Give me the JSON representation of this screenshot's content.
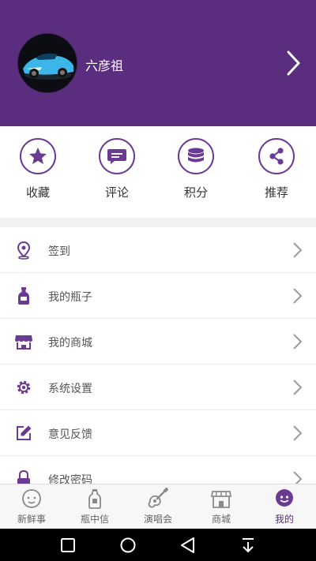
{
  "profile": {
    "username": "六彦祖"
  },
  "quick_actions": [
    {
      "label": "收藏",
      "icon": "star-icon"
    },
    {
      "label": "评论",
      "icon": "comment-icon"
    },
    {
      "label": "积分",
      "icon": "points-icon"
    },
    {
      "label": "推荐",
      "icon": "share-icon"
    }
  ],
  "menu": [
    {
      "label": "签到",
      "icon": "location-pin-icon"
    },
    {
      "label": "我的瓶子",
      "icon": "bottle-icon"
    },
    {
      "label": "我的商城",
      "icon": "store-icon"
    },
    {
      "label": "系统设置",
      "icon": "gear-icon"
    },
    {
      "label": "意见反馈",
      "icon": "edit-icon"
    },
    {
      "label": "修改密码",
      "icon": "lock-icon"
    }
  ],
  "tabs": [
    {
      "label": "新鲜事",
      "icon": "smiley-icon",
      "active": false
    },
    {
      "label": "瓶中信",
      "icon": "letter-bottle-icon",
      "active": false
    },
    {
      "label": "演唱会",
      "icon": "guitar-icon",
      "active": false
    },
    {
      "label": "商城",
      "icon": "shop-icon",
      "active": false
    },
    {
      "label": "我的",
      "icon": "profile-icon",
      "active": true
    }
  ],
  "colors": {
    "brand": "#5a2d7e",
    "accent": "#6b3a92"
  }
}
